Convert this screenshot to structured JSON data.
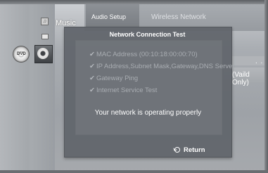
{
  "menu": {
    "music_label": "Music",
    "tabs": [
      "Audio Setup",
      "Wireless Network"
    ],
    "right_dots": ". .",
    "valid_only": "(Vaild Only)",
    "disc_label": "DVD"
  },
  "dialog": {
    "title": "Network Connection Test",
    "checks": [
      "MAC Address (00:10:18:00:00:70)",
      "IP Address,Subnet Mask,Gateway,DNS Server",
      "Gateway Ping",
      "Internet Service Test"
    ],
    "check_icon": "✔",
    "status": "Your network is operating properly",
    "return_label": "Return"
  },
  "colors": {
    "dialog_bg": "#60646a",
    "text": "#ffffff",
    "dim_text": "#a9adb2"
  },
  "icons": [
    "disc-icon",
    "music-icon",
    "photo-icon",
    "gear-icon",
    "return-icon",
    "check-icon"
  ]
}
